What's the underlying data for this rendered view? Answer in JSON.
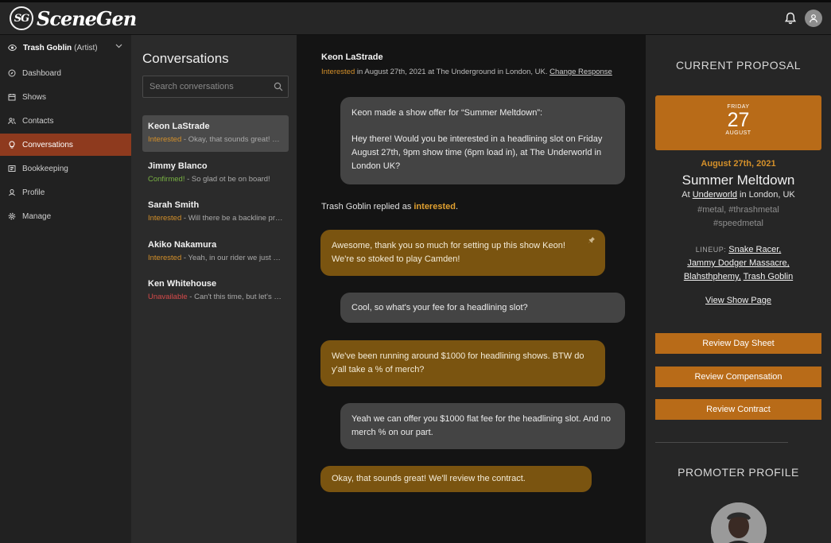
{
  "app": {
    "logo_badge": "SG",
    "logo_text": "SceneGen"
  },
  "icons": {
    "bell": "bell-icon",
    "user": "user-icon",
    "eye": "eye-icon",
    "chevron": "chevron-down-icon",
    "search": "search-icon",
    "pin": "pin-icon"
  },
  "sidebar": {
    "artist_name": "Trash Goblin",
    "artist_role": "(Artist)",
    "items": [
      {
        "label": "Dashboard",
        "icon": "compass-icon"
      },
      {
        "label": "Shows",
        "icon": "calendar-icon"
      },
      {
        "label": "Contacts",
        "icon": "contacts-icon"
      },
      {
        "label": "Conversations",
        "icon": "bulb-icon"
      },
      {
        "label": "Bookkeeping",
        "icon": "ledger-icon"
      },
      {
        "label": "Profile",
        "icon": "profile-icon"
      },
      {
        "label": "Manage",
        "icon": "gear-icon"
      }
    ],
    "active_index": 3
  },
  "conversations": {
    "title": "Conversations",
    "search_placeholder": "Search conversations",
    "items": [
      {
        "name": "Keon LaStrade",
        "status": "Interested",
        "status_type": "interested",
        "preview": " - Okay, that sounds great! We'll review the contract."
      },
      {
        "name": "Jimmy Blanco",
        "status": "Confirmed!",
        "status_type": "confirmed",
        "preview": " - So glad ot be on board!"
      },
      {
        "name": "Sarah Smith",
        "status": "Interested",
        "status_type": "interested",
        "preview": " - Will there be a backline provided?"
      },
      {
        "name": "Akiko Nakamura",
        "status": "Interested",
        "status_type": "interested",
        "preview": " - Yeah, in our rider we just ask for"
      },
      {
        "name": "Ken Whitehouse",
        "status": "Unavailable",
        "status_type": "unavailable",
        "preview": " - Can't this time, but let's keep in touch"
      }
    ]
  },
  "chat": {
    "contact_name": "Keon LaStrade",
    "status": "Interested",
    "status_detail": " in August 27th, 2021 at The Underground in London, UK. ",
    "change_link": "Change Response",
    "offer_title": "Keon made a show offer for “Summer Meltdown”:",
    "offer_body": "Hey there! Would you be interested in a headlining slot on Friday August 27th, 9pm show time (6pm load in), at The Underworld in London UK?",
    "reply_prefix": "Trash Goblin replied as ",
    "reply_status": "interested",
    "reply_suffix": ".",
    "messages": [
      {
        "side": "gold",
        "text": "Awesome, thank you so much for setting up this show Keon! We're so stoked to play Camden!"
      },
      {
        "side": "gray",
        "text": "Cool, so what's your fee for a headlining slot?"
      },
      {
        "side": "gold",
        "text": "We've been running around $1000 for headlining shows. BTW do y'all take a % of merch?"
      },
      {
        "side": "gray",
        "text": "Yeah we can offer you $1000 flat fee for the headlining slot. And no merch % on our part."
      },
      {
        "side": "gold",
        "text": "Okay, that sounds great! We'll review the contract."
      }
    ]
  },
  "proposal": {
    "heading": "CURRENT PROPOSAL",
    "weekday": "FRIDAY",
    "day": "27",
    "month": "AUGUST",
    "date_text": "August 27th, 2021",
    "show_name": "Summer Meltdown",
    "venue_prefix": "At ",
    "venue": "Underworld",
    "venue_suffix": " in London, UK",
    "tags": "#metal, #thrashmetal #speedmetal",
    "lineup_label": "LINEUP:",
    "lineup": [
      "Snake Racer,",
      "Jammy Dodger Massacre,",
      "Blahsthphemy,",
      "Trash Goblin"
    ],
    "view_link": "View Show Page",
    "buttons": [
      "Review Day Sheet",
      "Review Compensation",
      "Review Contract"
    ],
    "promoter_heading": "PROMOTER PROFILE"
  },
  "colors": {
    "accent": "#b86b18",
    "active_nav": "#8e3a1e",
    "bubble_gold": "#7a5410",
    "bubble_gray": "#444444",
    "interested": "#d4902a",
    "confirmed": "#78b043",
    "unavailable": "#d64a4a"
  }
}
